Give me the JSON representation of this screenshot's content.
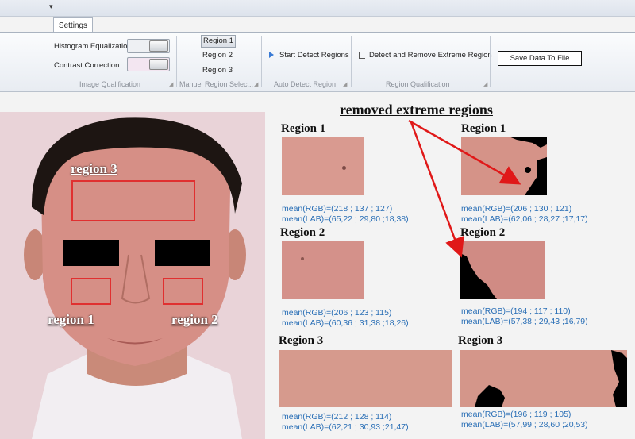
{
  "ribbon": {
    "quick_access_arrow": "▾",
    "tab_settings": "Settings",
    "image_qualification": {
      "histogram_label": "Histogram Equalization",
      "contrast_label": "Contrast Correction",
      "group_label": "Image Qualification"
    },
    "manual_region": {
      "region1": "Region 1",
      "region2": "Region 2",
      "region3": "Region 3",
      "group_label": "Manuel Region Selec..."
    },
    "auto_detect": {
      "start_label": "Start Detect Regions",
      "group_label": "Auto Detect Region"
    },
    "region_qualification": {
      "remove_label": "Detect and Remove Extreme Region",
      "group_label": "Region Qualification"
    },
    "save_label": "Save Data To File",
    "group_corner_icon": "◢"
  },
  "face": {
    "region3_label": "region 3",
    "region1_label": "region 1",
    "region2_label": "region 2"
  },
  "annotation": {
    "title": "removed extreme regions",
    "arrow_color": "#e01818"
  },
  "original_regions": [
    {
      "title": "Region 1",
      "rgb": "mean(RGB)=(218 ; 137 ; 127)",
      "lab": "mean(LAB)=(65,22 ; 29,80 ;18,38)"
    },
    {
      "title": "Region 2",
      "rgb": "mean(RGB)=(206 ; 123 ; 115)",
      "lab": "mean(LAB)=(60,36 ; 31,38 ;18,26)"
    },
    {
      "title": "Region 3",
      "rgb": "mean(RGB)=(212 ; 128 ; 114)",
      "lab": "mean(LAB)=(62,21 ; 30,93 ;21,47)"
    }
  ],
  "processed_regions": [
    {
      "title": "Region 1",
      "rgb": "mean(RGB)=(206 ; 130 ; 121)",
      "lab": "mean(LAB)=(62,06 ; 28,27 ;17,17)"
    },
    {
      "title": "Region 2",
      "rgb": "mean(RGB)=(194 ; 117 ; 110)",
      "lab": "mean(LAB)=(57,38 ; 29,43 ;16,79)"
    },
    {
      "title": "Region 3",
      "rgb": "mean(RGB)=(196 ; 119 ; 105)",
      "lab": "mean(LAB)=(57,99 ; 28,60 ;20,53)"
    }
  ],
  "colors": {
    "stat_text": "#2a6fb6",
    "box_red": "#e03030",
    "skin": "#d89088"
  }
}
